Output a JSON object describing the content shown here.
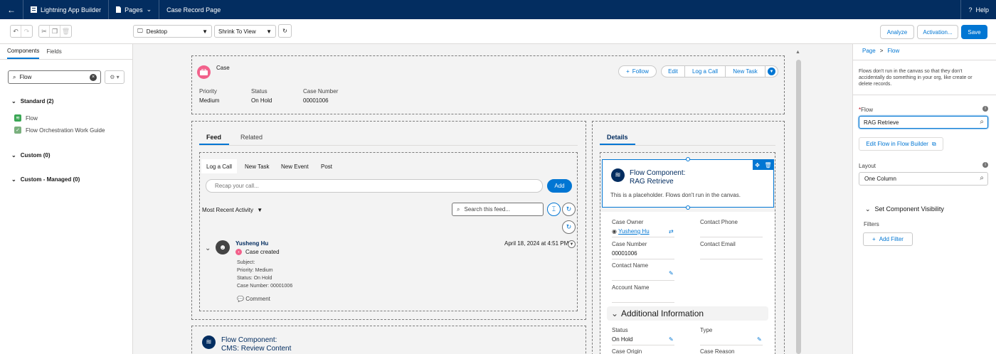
{
  "topbar": {
    "app_name": "Lightning App Builder",
    "pages_label": "Pages",
    "page_title": "Case Record Page",
    "help_label": "Help"
  },
  "toolbar": {
    "device": "Desktop",
    "zoom": "Shrink To View",
    "analyze": "Analyze",
    "activation": "Activation...",
    "save": "Save"
  },
  "left": {
    "tabs": [
      "Components",
      "Fields"
    ],
    "search_value": "Flow",
    "sections": {
      "standard": "Standard (2)",
      "custom": "Custom (0)",
      "managed": "Custom - Managed (0)"
    },
    "components": [
      "Flow",
      "Flow Orchestration Work Guide"
    ]
  },
  "header": {
    "object": "Case",
    "follow": "Follow",
    "actions": [
      "Edit",
      "Log a Call",
      "New Task"
    ],
    "fields": [
      {
        "label": "Priority",
        "value": "Medium"
      },
      {
        "label": "Status",
        "value": "On Hold"
      },
      {
        "label": "Case Number",
        "value": "00001006"
      }
    ]
  },
  "feed": {
    "tabs": [
      "Feed",
      "Related"
    ],
    "publisher_tabs": [
      "Log a Call",
      "New Task",
      "New Event",
      "Post"
    ],
    "recap_placeholder": "Recap your call...",
    "add": "Add",
    "sort": "Most Recent Activity",
    "search_placeholder": "Search this feed...",
    "item": {
      "user": "Yusheng Hu",
      "action": "Case created",
      "time": "April 18, 2024 at 4:51 PM",
      "lines": [
        "Subject:",
        "Priority: Medium",
        "Status: On Hold",
        "Case Number: 00001006"
      ],
      "comment": "Comment"
    }
  },
  "bottom_flow": {
    "title": "Flow Component:",
    "name": "CMS: Review Content"
  },
  "details": {
    "tab": "Details",
    "flow_title": "Flow Component:",
    "flow_name": "RAG Retrieve",
    "flow_note": "This is a placeholder. Flows don't run in the canvas.",
    "fields_left": [
      {
        "label": "Case Owner",
        "value": "Yusheng Hu"
      },
      {
        "label": "Case Number",
        "value": "00001006"
      },
      {
        "label": "Contact Name",
        "value": ""
      },
      {
        "label": "Account Name",
        "value": ""
      }
    ],
    "fields_right": [
      {
        "label": "Contact Phone",
        "value": ""
      },
      {
        "label": "Contact Email",
        "value": ""
      }
    ],
    "section": "Additional Information",
    "extra": [
      {
        "label": "Status",
        "value": "On Hold"
      },
      {
        "label": "Type",
        "value": ""
      },
      {
        "label": "Case Origin",
        "value": ""
      },
      {
        "label": "Case Reason",
        "value": ""
      }
    ]
  },
  "right": {
    "breadcrumb_page": "Page",
    "breadcrumb_sep": ">",
    "breadcrumb_flow": "Flow",
    "note": "Flows don't run in the canvas so that they don't accidentally do something in your org, like create or delete records.",
    "flow_label": "Flow",
    "flow_value": "RAG Retrieve",
    "edit_link": "Edit Flow in Flow Builder",
    "layout_label": "Layout",
    "layout_value": "One Column",
    "visibility": "Set Component Visibility",
    "filters": "Filters",
    "add_filter": "Add Filter"
  }
}
